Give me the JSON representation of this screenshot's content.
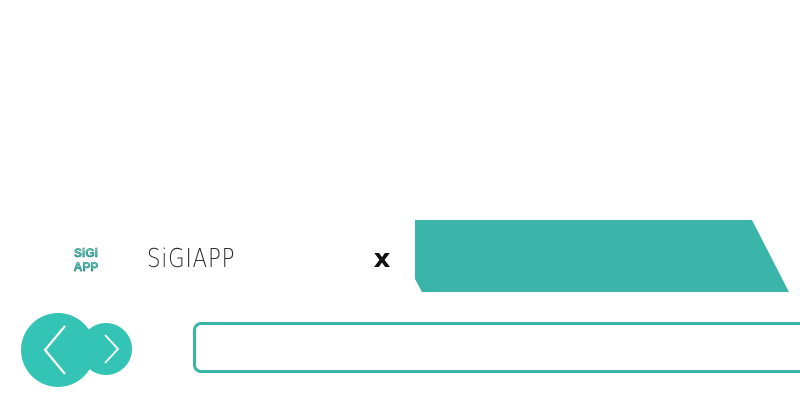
{
  "tab": {
    "logo_text": "SiGi APP",
    "title": "SiGIAPP",
    "close_label": "x"
  },
  "new_tab": {
    "label": ""
  },
  "navigation": {
    "back_icon": "chevron-left-icon",
    "forward_icon": "chevron-right-icon"
  },
  "address_bar": {
    "value": "",
    "placeholder": ""
  },
  "colors": {
    "accent": "#3bb5a9",
    "accent_light": "#33c4b6",
    "text": "#2c2c2c",
    "background": "#ffffff"
  }
}
